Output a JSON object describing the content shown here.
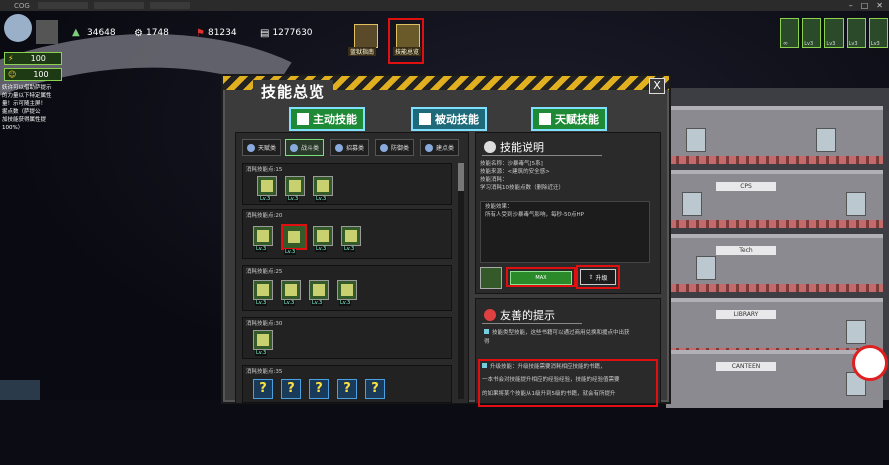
{
  "window": {
    "title": "COG"
  },
  "hud": {
    "stat1": "34648",
    "stat2": "1748",
    "stat3": "81234",
    "stat4": "1277630",
    "energy": "100",
    "happiness": "100",
    "unit_counts": [
      "∞",
      "Lv3",
      "Lv3",
      "Lv3",
      "Lv3"
    ]
  },
  "top_buttons": [
    {
      "label": "蓝狱指南"
    },
    {
      "label": "技能总览"
    }
  ],
  "tooltip_lines": [
    "妖许可以借助萨提示",
    "的力量以下特定属性",
    "量！示可随主屏！",
    "掘点数（萨提公",
    "加技能获得属性提",
    "100%）"
  ],
  "panel": {
    "title": "技能总览",
    "close": "X",
    "main_tabs": [
      "主动技能",
      "被动技能",
      "天赋技能"
    ],
    "sub_tabs": [
      "天赋类",
      "战斗类",
      "招募类",
      "防御类",
      "建点类"
    ],
    "groups": [
      {
        "label": "消耗技能点:15",
        "levels": [
          "Lv.3",
          "Lv.3",
          "Lv.3"
        ]
      },
      {
        "label": "消耗技能点:20",
        "levels": [
          "Lv.3",
          "Lv.3",
          "Lv.3",
          "Lv.3"
        ]
      },
      {
        "label": "消耗技能点:25",
        "levels": [
          "Lv.3",
          "Lv.3",
          "Lv.3",
          "Lv.3"
        ]
      },
      {
        "label": "消耗技能点:30",
        "levels": [
          "Lv.3"
        ]
      },
      {
        "label": "消耗技能点:35",
        "levels": [
          "?",
          "?",
          "?",
          "?",
          "?"
        ]
      }
    ]
  },
  "detail": {
    "title": "技能说明",
    "lines": [
      "技能名称：沙暴毒气[5系]",
      "技能来源：<建筑的安全感>",
      "技能消耗：",
      "学习消耗10技能点数（删除近迁）",
      "技能效果：",
      "所有人受到沙暴毒气影响，每秒-50点HP"
    ],
    "max_label": "MAX",
    "upgrade_label": "升级"
  },
  "hint": {
    "title": "友善的提示",
    "lines": [
      "技能类型技能，这些书籍可以通过商用兑换和援点中出获",
      "得",
      "升级技能：升级技能需要消耗相应技能的书籍，",
      "一本书会对技能提升相应的经验经验，技能的经验值需要",
      "的如果将某个技能从1级升到5级的书籍，就会有所提升"
    ]
  },
  "colors": {
    "accent_green": "#1f8a36",
    "highlight_red": "#e01010"
  }
}
